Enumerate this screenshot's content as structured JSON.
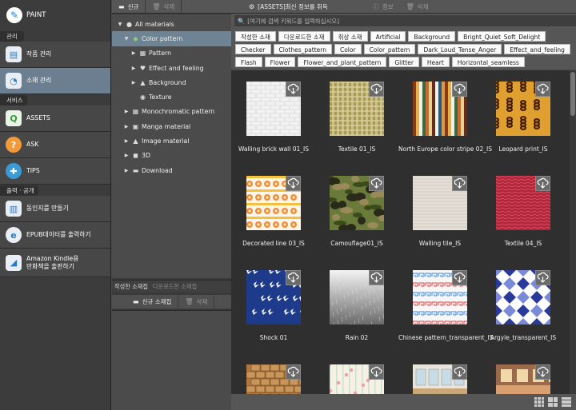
{
  "sidebar": {
    "app_name": "PAINT",
    "sections": [
      {
        "header": "관리",
        "items": [
          {
            "label": "작품 관리",
            "icon": "document-icon"
          },
          {
            "label": "소재 관리",
            "icon": "materials-icon",
            "active": true
          }
        ]
      },
      {
        "header": "서비스",
        "items": [
          {
            "label": "ASSETS",
            "icon": "assets-icon"
          },
          {
            "label": "ASK",
            "icon": "question-icon"
          },
          {
            "label": "TIPS",
            "icon": "tips-icon"
          }
        ]
      },
      {
        "header": "출력 · 공개",
        "items": [
          {
            "label": "동인지를 만들기",
            "icon": "book-icon"
          },
          {
            "label": "EPUB데이터를 출력하기",
            "icon": "epub-icon"
          },
          {
            "label1": "Amazon Kindle용",
            "label2": "만화책을 출판하기",
            "icon": "kindle-icon"
          }
        ]
      }
    ]
  },
  "tree_toolbar": {
    "new_label": "신규",
    "delete_label": "삭제"
  },
  "tree": {
    "root": "All materials",
    "color_pattern": "Color pattern",
    "pattern": "Pattern",
    "effect": "Effect and feeling",
    "background": "Background",
    "texture": "Texture",
    "monochromatic": "Monochromatic pattern",
    "manga": "Manga material",
    "image": "Image material",
    "three_d": "3D",
    "download": "Download"
  },
  "lower_tabs": {
    "created": "작성한 소재집",
    "downloaded": "다운로드한 소재집"
  },
  "lower_toolbar": {
    "new_label": "신규 소재집",
    "delete_label": "삭제"
  },
  "top_bar": {
    "assets_label": "[ASSETS]최신 정보를 취득",
    "info_label": "정보",
    "delete_label": "삭제"
  },
  "search": {
    "placeholder": "[여기에 검색 키워드를 입력하십시오]"
  },
  "tags": [
    "작성한 소재",
    "다운로드한 소재",
    "취상 소재",
    "Artificial",
    "Background",
    "Bright_Quiet_Soft_Delight",
    "Checker",
    "Clothes_pattern",
    "Color",
    "Color_pattern",
    "Dark_Loud_Tense_Anger",
    "Effect_and_feeling",
    "Flash",
    "Flower",
    "Flower_and_plant_pattern",
    "Glitter",
    "Heart",
    "Horizontal_seamless"
  ],
  "materials": [
    {
      "name": "Walling brick wall 01_IS",
      "pattern": "brick"
    },
    {
      "name": "Textile 01_IS",
      "pattern": "textile"
    },
    {
      "name": "North Europe color stripe 02_IS",
      "pattern": "stripe"
    },
    {
      "name": "Leopard print_IS",
      "pattern": "leopard"
    },
    {
      "name": "Decorated line 03_IS",
      "pattern": "decor"
    },
    {
      "name": "Camouflage01_IS",
      "pattern": "camo"
    },
    {
      "name": "Walling tile_IS",
      "pattern": "tile"
    },
    {
      "name": "Textile 04_IS",
      "pattern": "textile4"
    },
    {
      "name": "Shock 01",
      "pattern": "shock"
    },
    {
      "name": "Rain 02",
      "pattern": "rain"
    },
    {
      "name": "Chinese pattern_transparent_IS",
      "pattern": "chinese"
    },
    {
      "name": "Argyle_transparent_IS",
      "pattern": "argyle"
    },
    {
      "name": "",
      "pattern": "stone"
    },
    {
      "name": "",
      "pattern": "floral"
    },
    {
      "name": "",
      "pattern": "classroom"
    },
    {
      "name": "",
      "pattern": "room"
    }
  ]
}
